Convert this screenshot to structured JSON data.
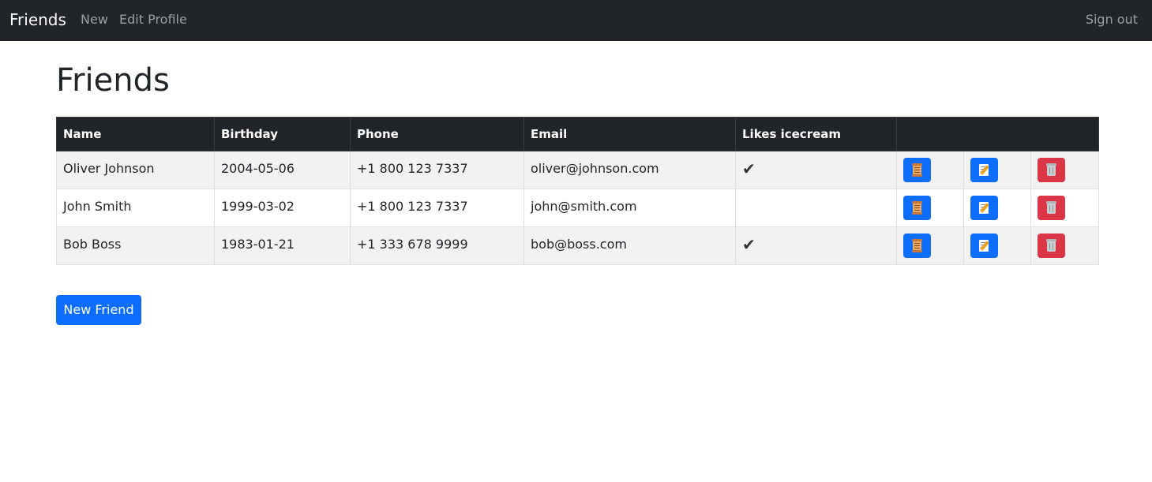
{
  "navbar": {
    "brand": "Friends",
    "links": [
      "New",
      "Edit Profile"
    ],
    "signout": "Sign out"
  },
  "page_title": "Friends",
  "table": {
    "headers": [
      "Name",
      "Birthday",
      "Phone",
      "Email",
      "Likes icecream",
      ""
    ],
    "rows": [
      {
        "name": "Oliver Johnson",
        "birthday": "2004-05-06",
        "phone": "+1 800 123 7337",
        "email": "oliver@johnson.com",
        "likes_icecream": "✔"
      },
      {
        "name": "John Smith",
        "birthday": "1999-03-02",
        "phone": "+1 800 123 7337",
        "email": "john@smith.com",
        "likes_icecream": ""
      },
      {
        "name": "Bob Boss",
        "birthday": "1983-01-21",
        "phone": "+1 333 678 9999",
        "email": "bob@boss.com",
        "likes_icecream": "✔"
      }
    ],
    "row_actions": [
      {
        "icon": "scroll-icon",
        "color": "#0d6efd"
      },
      {
        "icon": "memo-icon",
        "color": "#0d6efd"
      },
      {
        "icon": "trash-icon",
        "color": "#dc3545"
      }
    ]
  },
  "new_friend_button": "New Friend",
  "colors": {
    "navbar": "#212529",
    "primary": "#0d6efd",
    "danger": "#dc3545",
    "striped_row": "#f2f2f2"
  }
}
